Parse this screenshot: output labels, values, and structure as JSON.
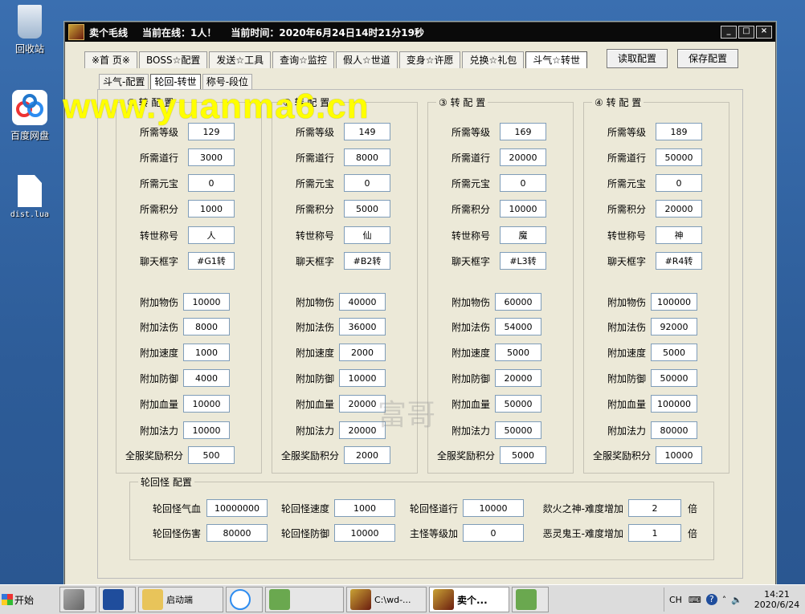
{
  "desktop": {
    "icons": [
      {
        "label": "回收站"
      },
      {
        "label": "百度网盘"
      },
      {
        "label": "dist.lua"
      }
    ]
  },
  "window": {
    "title": "卖个毛线",
    "online": "当前在线：1人！",
    "time": "当前时间：2020年6月24日14时21分19秒",
    "ctrls": [
      "_",
      "□",
      "×"
    ]
  },
  "tabs": [
    "※首 页※",
    "BOSS☆配置",
    "发送☆工具",
    "查询☆监控",
    "假人☆世道",
    "变身☆许愿",
    "兑换☆礼包",
    "斗气☆转世"
  ],
  "buttons": {
    "read": "读取配置",
    "save": "保存配置"
  },
  "subtabs": [
    "斗气-配置",
    "轮回-转世",
    "称号-段位"
  ],
  "labels": {
    "level": "所需等级",
    "dao": "所需道行",
    "yuanbao": "所需元宝",
    "score": "所需积分",
    "title": "转世称号",
    "chat": "聊天框字",
    "phy": "附加物伤",
    "mag": "附加法伤",
    "speed": "附加速度",
    "def": "附加防御",
    "hp": "附加血量",
    "mp": "附加法力",
    "server": "全服奖励积分"
  },
  "groups": [
    {
      "title": "① 转 配 置",
      "level": "129",
      "dao": "3000",
      "yuanbao": "0",
      "score": "1000",
      "title_name": "人",
      "chat": "#G1转",
      "phy": "10000",
      "mag": "8000",
      "speed": "1000",
      "def": "4000",
      "hp": "10000",
      "mp": "10000",
      "server": "500"
    },
    {
      "title": "② 转 配 置",
      "level": "149",
      "dao": "8000",
      "yuanbao": "0",
      "score": "5000",
      "title_name": "仙",
      "chat": "#B2转",
      "phy": "40000",
      "mag": "36000",
      "speed": "2000",
      "def": "10000",
      "hp": "20000",
      "mp": "20000",
      "server": "2000"
    },
    {
      "title": "③ 转 配 置",
      "level": "169",
      "dao": "20000",
      "yuanbao": "0",
      "score": "10000",
      "title_name": "魔",
      "chat": "#L3转",
      "phy": "60000",
      "mag": "54000",
      "speed": "5000",
      "def": "20000",
      "hp": "50000",
      "mp": "50000",
      "server": "5000"
    },
    {
      "title": "④ 转 配 置",
      "level": "189",
      "dao": "50000",
      "yuanbao": "0",
      "score": "20000",
      "title_name": "神",
      "chat": "#R4转",
      "phy": "100000",
      "mag": "92000",
      "speed": "5000",
      "def": "50000",
      "hp": "100000",
      "mp": "80000",
      "server": "10000"
    }
  ],
  "monster": {
    "title": "轮回怪 配置",
    "hp_label": "轮回怪气血",
    "hp": "10000000",
    "speed_label": "轮回怪速度",
    "speed": "1000",
    "dao_label": "轮回怪道行",
    "dao": "10000",
    "fire_label": "欻火之神-难度增加",
    "fire": "2",
    "dmg_label": "轮回怪伤害",
    "dmg": "80000",
    "def_label": "轮回怪防御",
    "def": "10000",
    "lvl_label": "主怪等级加",
    "lvl": "0",
    "ghost_label": "恶灵鬼王-难度增加",
    "ghost": "1",
    "times": "倍"
  },
  "watermark": "www.yuanma6.cn",
  "watermark2": "富哥",
  "taskbar": {
    "start": "开始",
    "items": [
      "启动端",
      "C:\\wd-...",
      "卖个..."
    ],
    "lang": "CH",
    "time": "14:21",
    "date": "2020/6/24"
  }
}
